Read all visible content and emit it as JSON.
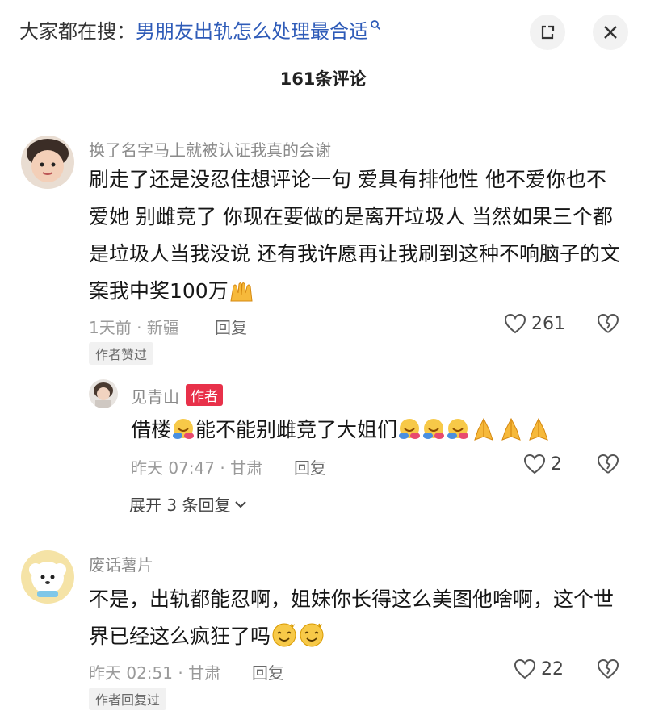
{
  "header": {
    "search_prefix": "大家都在搜：",
    "search_query": "男朋友出轨怎么处理最合适",
    "share_icon": "share-icon",
    "close_icon": "close-icon"
  },
  "comment_count_title": "161条评论",
  "comments": [
    {
      "username": "换了名字马上就被认证我真的会谢",
      "text": "刷走了还是没忍住想评论一句 爱具有排他性 他不爱你也不爱她 别雌竞了 你现在要做的是离开垃圾人 当然如果三个都是垃圾人当我没说 还有我许愿再让我刷到这种不响脑子的文案我中奖100万",
      "emoji": "raised-hands",
      "meta": "1天前 · 新疆",
      "reply_label": "回复",
      "likes": "261",
      "tag": "作者赞过"
    },
    {
      "username": "废话薯片",
      "text": "不是，出轨都能忍啊，姐妹你长得这么美图他啥啊，这个世界已经这么疯狂了吗",
      "meta": "昨天 02:51 · 甘肃",
      "reply_label": "回复",
      "likes": "22",
      "tag": "作者回复过"
    }
  ],
  "reply": {
    "username": "见青山",
    "badge": "作者",
    "text": "借楼",
    "text2": "能不能别雌竞了大姐们",
    "meta": "昨天 07:47 · 甘肃",
    "reply_label": "回复",
    "likes": "2"
  },
  "expand_label": "展开 3 条回复"
}
